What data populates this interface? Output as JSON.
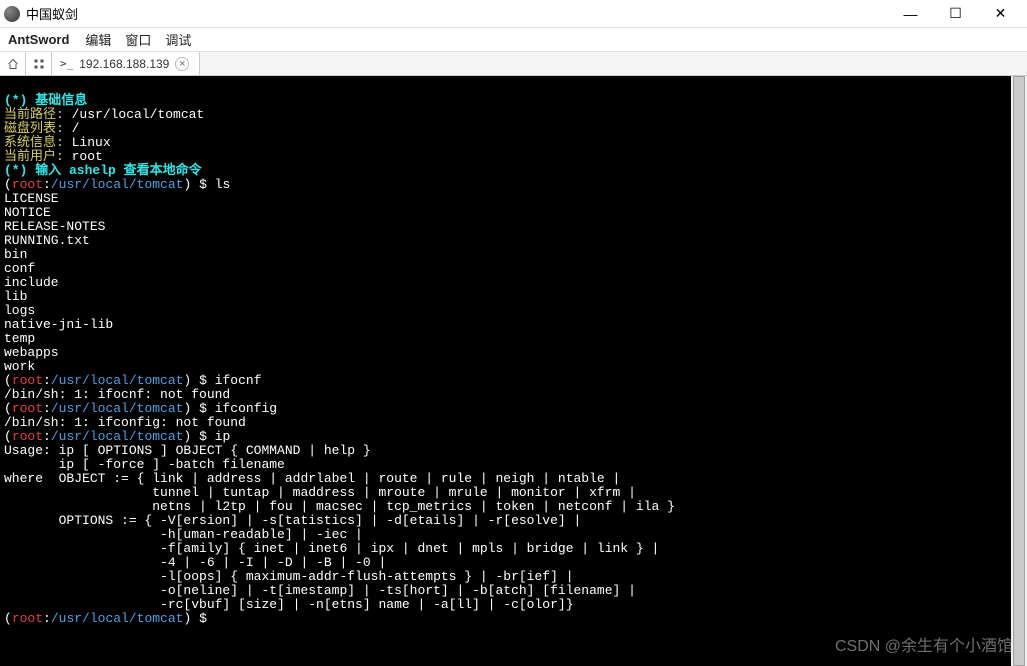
{
  "window": {
    "title": "中国蚁剑",
    "controls": {
      "min": "—",
      "max": "☐",
      "close": "✕"
    }
  },
  "menubar": {
    "brand": "AntSword",
    "items": [
      "编辑",
      "窗口",
      "调试"
    ]
  },
  "tabbar": {
    "home_icon": "⟨",
    "grid_icon": "▦",
    "tab_icon": ">_",
    "tab_label": "192.168.188.139",
    "close": "×"
  },
  "terminal": {
    "section1_title": "(*) 基础信息",
    "info": {
      "path_label": "当前路径: ",
      "path_value": "/usr/local/tomcat",
      "disk_label": "磁盘列表: ",
      "disk_value": "/",
      "sys_label": "系统信息: ",
      "sys_value": "Linux",
      "user_label": "当前用户: ",
      "user_value": "root"
    },
    "section2_title": "(*) 输入 ashelp 查看本地命令",
    "prompt_open": "(",
    "prompt_user": "root",
    "prompt_sep": ":",
    "prompt_path": "/usr/local/tomcat",
    "prompt_close": ") $ ",
    "cmd1": "ls",
    "ls_output": "LICENSE\nNOTICE\nRELEASE-NOTES\nRUNNING.txt\nbin\nconf\ninclude\nlib\nlogs\nnative-jni-lib\ntemp\nwebapps\nwork",
    "cmd2": "ifocnf",
    "cmd2_out": "/bin/sh: 1: ifocnf: not found",
    "cmd3": "ifconfig",
    "cmd3_out": "/bin/sh: 1: ifconfig: not found",
    "cmd4": "ip",
    "ip_out": "Usage: ip [ OPTIONS ] OBJECT { COMMAND | help }\n       ip [ -force ] -batch filename\nwhere  OBJECT := { link | address | addrlabel | route | rule | neigh | ntable |\n                   tunnel | tuntap | maddress | mroute | mrule | monitor | xfrm |\n                   netns | l2tp | fou | macsec | tcp_metrics | token | netconf | ila }\n       OPTIONS := { -V[ersion] | -s[tatistics] | -d[etails] | -r[esolve] |\n                    -h[uman-readable] | -iec |\n                    -f[amily] { inet | inet6 | ipx | dnet | mpls | bridge | link } |\n                    -4 | -6 | -I | -D | -B | -0 |\n                    -l[oops] { maximum-addr-flush-attempts } | -br[ief] |\n                    -o[neline] | -t[imestamp] | -ts[hort] | -b[atch] [filename] |\n                    -rc[vbuf] [size] | -n[etns] name | -a[ll] | -c[olor]}"
  },
  "watermark": "CSDN @余生有个小酒馆"
}
